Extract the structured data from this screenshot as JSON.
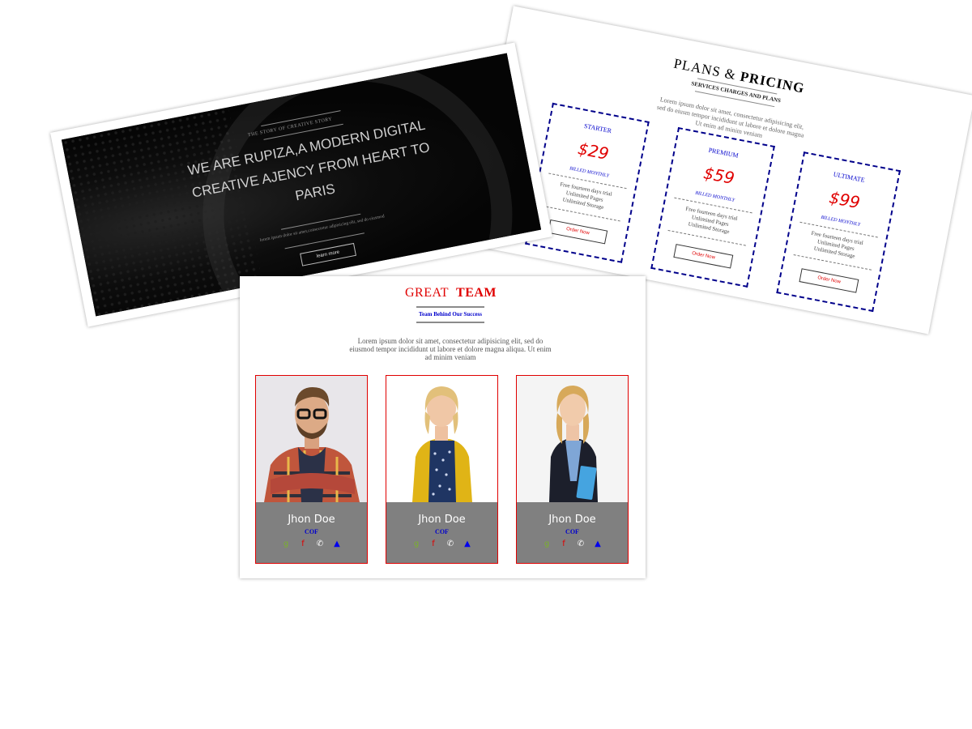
{
  "colors": {
    "accent_red": "#e00000",
    "accent_blue": "#0000cc",
    "plan_border": "#00008b",
    "member_footer": "#808080"
  },
  "pricing": {
    "title_light": "PLANS &",
    "title_bold": "PRICING",
    "subtitle": "SERVICES CHARGES AND PLANS",
    "description": "Lorem ipsum dolor sit amet, consectetur adipisicing elit, sed do eiusm tempor incididunt ut labore et dolore magna Ut enim ad minim veniam",
    "plans": [
      {
        "name": "STARTER",
        "price": "$29",
        "billed": "BILLED MONTHLY",
        "features": [
          "Free fourteen days trial",
          "Unlimited Pages",
          "Unlimited Storage"
        ],
        "button": "Order Now"
      },
      {
        "name": "PREMIUM",
        "price": "$59",
        "billed": "BILLED MONTHLY",
        "features": [
          "Free fourteen days trial",
          "Unlimited Pages",
          "Unlimited Storage"
        ],
        "button": "Order Now"
      },
      {
        "name": "ULTIMATE",
        "price": "$99",
        "billed": "BILLED MONTHLY",
        "features": [
          "Free fourteen days trial",
          "Unlimited Pages",
          "Unlimited Storage"
        ],
        "button": "Order Now"
      }
    ]
  },
  "hero": {
    "kicker": "THE STORY OF CREATIVE STORY",
    "headline": "WE ARE RUPIZA,A MODERN DIGITAL CREATIVE AJENCY FROM HEART TO PARIS",
    "description": "lorem ipsum dolor sit amet,consectetur adipisicing elit, sed do eiusmod",
    "button": "learn more"
  },
  "team": {
    "title_light": "GREAT",
    "title_bold": "TEAM",
    "subtitle": "Team Behind Our Success",
    "description": "Lorem ipsum dolor sit amet, consectetur adipisicing elit, sed do eiusmod tempor incididunt ut labore et dolore magna aliqua. Ut enim ad minim veniam",
    "members": [
      {
        "name": "Jhon Doe",
        "role": "COF"
      },
      {
        "name": "Jhon Doe",
        "role": "COF"
      },
      {
        "name": "Jhon Doe",
        "role": "COF"
      }
    ],
    "social_icons": [
      {
        "icon": "google-plus-icon",
        "glyph": "g",
        "color": "#7ab02c"
      },
      {
        "icon": "facebook-icon",
        "glyph": "f",
        "color": "#e00000"
      },
      {
        "icon": "whatsapp-icon",
        "glyph": "✆",
        "color": "#ffffff"
      },
      {
        "icon": "twitter-icon",
        "glyph": "🐦",
        "color": "#0000ee"
      }
    ]
  }
}
